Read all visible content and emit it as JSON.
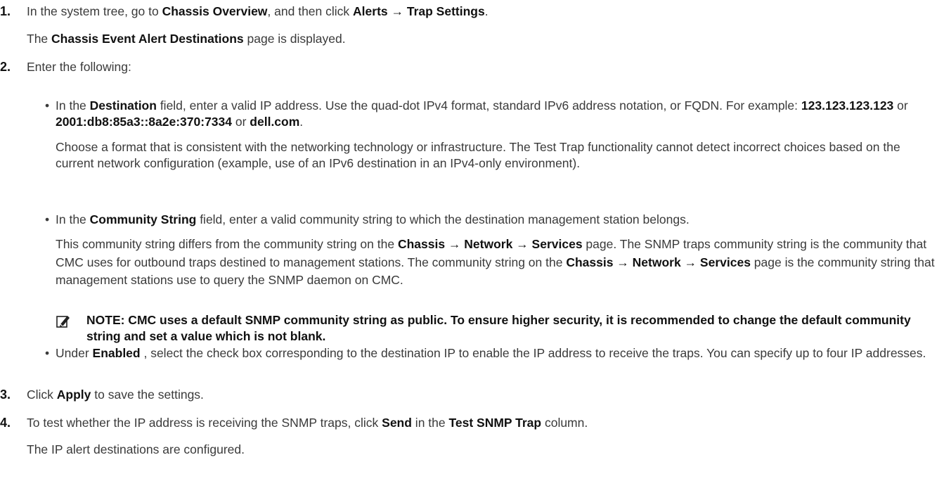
{
  "steps": [
    {
      "number": "1.",
      "parts": [
        "In the system tree, go to ",
        "Chassis Overview",
        ", and then click ",
        "Alerts → Trap Settings",
        "."
      ],
      "result_parts": [
        "The ",
        "Chassis Event Alert Destinations",
        " page is displayed."
      ]
    },
    {
      "number": "2.",
      "intro": "Enter the following:",
      "bullets": [
        {
          "bullet": "•",
          "p1_parts": [
            "In the ",
            "Destination",
            " field, enter a valid IP address. Use the quad-dot IPv4 format, standard IPv6 address notation, or FQDN. For example: ",
            "123.123.123.123",
            " or ",
            "2001:db8:85a3::8a2e:370:7334",
            " or ",
            "dell.com",
            "."
          ],
          "p2": "Choose a format that is consistent with the networking technology or infrastructure. The Test Trap functionality cannot detect incorrect choices based on the current network configuration (example, use of an IPv6 destination in an IPv4-only environment)."
        },
        {
          "bullet": "•",
          "p1_parts": [
            "In the ",
            "Community String",
            " field, enter a valid community string to which the destination management station belongs."
          ],
          "p2_parts": [
            "This community string differs from the community string on the ",
            "Chassis → Network → Services",
            " page. The SNMP traps community string is the community that CMC uses for outbound traps destined to management stations. The community string on the ",
            "Chassis → Network → Services",
            " page is the community string that management stations use to query the SNMP daemon on CMC."
          ],
          "note": "NOTE: CMC uses a default SNMP community string as public. To ensure higher security, it is recommended to change the default community string and set a value which is not blank."
        },
        {
          "bullet": "•",
          "p1_parts": [
            "Under ",
            "Enabled",
            " , select the check box corresponding to the destination IP to enable the IP address to receive the traps. You can specify up to four IP addresses."
          ]
        }
      ]
    },
    {
      "number": "3.",
      "parts": [
        "Click ",
        "Apply",
        " to save the settings."
      ]
    },
    {
      "number": "4.",
      "parts": [
        "To test whether the IP address is receiving the SNMP traps, click ",
        "Send",
        " in the ",
        "Test SNMP Trap",
        " column."
      ],
      "result": "The IP alert destinations are configured."
    }
  ],
  "icons": {
    "note": "pencil-note-icon"
  }
}
